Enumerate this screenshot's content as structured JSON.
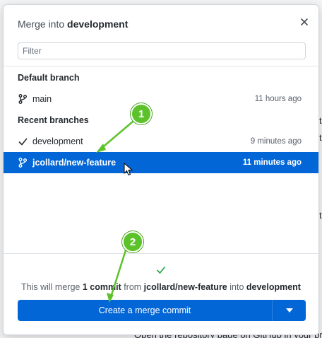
{
  "background": {
    "footer_text": "Open the repository page on GitHub in your brow",
    "edge_glyph": "t"
  },
  "dialog": {
    "title_prefix": "Merge into ",
    "title_target": "development",
    "filter_placeholder": "Filter",
    "filter_value": ""
  },
  "sections": {
    "default_header": "Default branch",
    "recent_header": "Recent branches"
  },
  "branches": {
    "main": {
      "name": "main",
      "time": "11 hours ago",
      "icon": "git-branch-icon"
    },
    "development": {
      "name": "development",
      "time": "9 minutes ago",
      "icon": "check-icon"
    },
    "feature": {
      "name": "jcollard/new-feature",
      "time": "11 minutes ago",
      "icon": "git-branch-icon",
      "selected": true
    }
  },
  "footer": {
    "summary": {
      "pre": "This will merge ",
      "count": "1 commit",
      "mid": " from ",
      "source": "jcollard/new-feature",
      "into": " into ",
      "target": "development"
    },
    "merge_button": "Create a merge commit"
  },
  "annotations": {
    "callout_1": "1",
    "callout_2": "2"
  },
  "colors": {
    "accent": "#0366d6",
    "success": "#28a745",
    "callout": "#5cc22a"
  }
}
